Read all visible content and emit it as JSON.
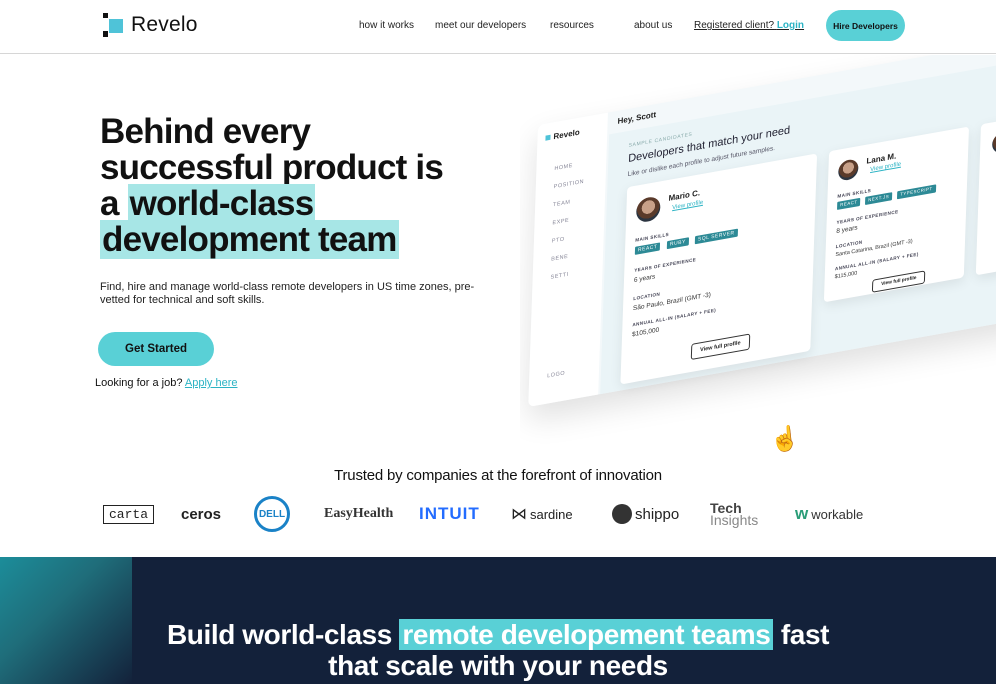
{
  "nav": {
    "logo_text": "Revelo",
    "links": [
      "how it works",
      "meet our developers",
      "resources",
      "about us"
    ],
    "registered_text": "Registered client?",
    "login_label": "Login",
    "hire_button": "Hire Developers"
  },
  "hero": {
    "headline_line1": "Behind every",
    "headline_line2": "successful  product is",
    "headline_line3_pre": "a ",
    "headline_line3_hl": "world-class",
    "headline_line4_hl": "development team",
    "subtitle": "Find, hire and manage world-class remote developers in US time zones, pre-vetted for technical and soft skills.",
    "cta_label": "Get Started",
    "job_text": "Looking for a job?",
    "job_link": "Apply here"
  },
  "mockup": {
    "logo": "Revelo",
    "greeting": "Hey, Scott",
    "section_label": "SAMPLE CANDIDATES",
    "title": "Developers that match your need",
    "description": "Like or dislike each profile to adjust future samples.",
    "sidebar": [
      "HOME",
      "POSITION",
      "TEAM",
      "EXPE",
      "PTO",
      "BENE",
      "SETTI",
      "LOGO"
    ],
    "candidates": [
      {
        "name": "Mario C.",
        "view": "View profile",
        "skills_label": "MAIN SKILLS",
        "skills": [
          "REACT",
          "RUBY",
          "SQL SERVER"
        ],
        "exp_label": "YEARS OF EXPERIENCE",
        "exp": "6 years",
        "loc_label": "LOCATION",
        "location": "São Paulo, Brazil (GMT -3)",
        "salary_label": "ANNUAL ALL-IN (SALARY + FEE)",
        "salary": "$105,000",
        "button": "View full profile"
      },
      {
        "name": "Lana M.",
        "view": "View profile",
        "skills_label": "MAIN SKILLS",
        "skills": [
          "REACT",
          "NEXT.JS",
          "TYPESCRIPT"
        ],
        "exp_label": "YEARS OF EXPERIENCE",
        "exp": "8 years",
        "loc_label": "LOCATION",
        "location": "Santa Catarina, Brazil (GMT -3)",
        "salary_label": "ANNUAL ALL-IN (SALARY + FEE)",
        "salary": "$115,000",
        "button": "View full profile"
      }
    ]
  },
  "trusted": {
    "title": "Trusted by companies at the forefront of innovation",
    "logos": [
      "carta",
      "ceros",
      "DELL",
      "EasyHealth",
      "INTUIT",
      "sardine",
      "shippo",
      "Tech",
      "Insights",
      "workable"
    ]
  },
  "bottom": {
    "title_pre": "Build world-class ",
    "title_hl": "remote developement teams",
    "title_post": " fast",
    "title_line2": "that scale with your needs"
  }
}
